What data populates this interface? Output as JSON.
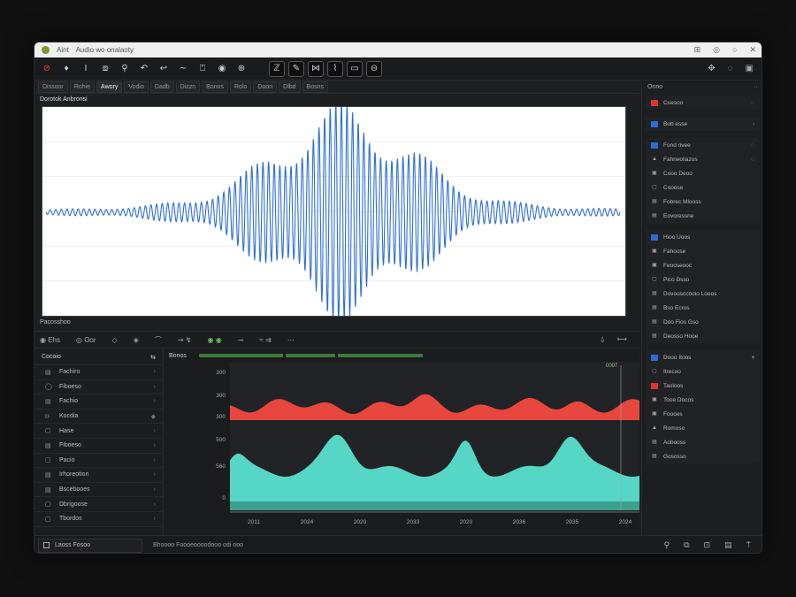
{
  "window": {
    "title_prefix": "Aint",
    "title": "Audio wo onalaoty",
    "controls": [
      "⊞",
      "◎",
      "○",
      "✕"
    ]
  },
  "toolbar": {
    "left_icons": [
      {
        "name": "record-icon",
        "glyph": "⊘"
      },
      {
        "name": "pin-icon",
        "glyph": "♦"
      },
      {
        "name": "cursor-icon",
        "glyph": "I"
      },
      {
        "name": "screen-icon",
        "glyph": "⧈"
      },
      {
        "name": "search-icon",
        "glyph": "⚲"
      },
      {
        "name": "undo-icon",
        "glyph": "↶"
      },
      {
        "name": "back-icon",
        "glyph": "↩"
      },
      {
        "name": "wave-icon",
        "glyph": "∼"
      },
      {
        "name": "marker-icon",
        "glyph": "⍞"
      },
      {
        "name": "mic-icon",
        "glyph": "◉"
      },
      {
        "name": "zoom-icon",
        "glyph": "⊕"
      }
    ],
    "boxed_icons": [
      {
        "name": "trim-icon",
        "glyph": "ℤ"
      },
      {
        "name": "pen-icon",
        "glyph": "✎"
      },
      {
        "name": "split-icon",
        "glyph": "⋈"
      },
      {
        "name": "envelope-icon",
        "glyph": "⌇"
      },
      {
        "name": "frame-icon",
        "glyph": "▭"
      },
      {
        "name": "clock-icon",
        "glyph": "⊖"
      }
    ],
    "right_icons": [
      {
        "name": "move-icon",
        "glyph": "✥"
      },
      {
        "name": "chat-icon",
        "glyph": "◌"
      },
      {
        "name": "save-icon",
        "glyph": "▣"
      }
    ]
  },
  "tabs": [
    {
      "label": "Dissoor",
      "active": false
    },
    {
      "label": "Rohie",
      "active": false
    },
    {
      "label": "Awory",
      "active": true
    },
    {
      "label": "Vodio",
      "active": false
    },
    {
      "label": "Dadb",
      "active": false
    },
    {
      "label": "Dizzn",
      "active": false
    },
    {
      "label": "Bonos",
      "active": false
    },
    {
      "label": "Rolo",
      "active": false
    },
    {
      "label": "Doon",
      "active": false
    },
    {
      "label": "Dlbd",
      "active": false
    },
    {
      "label": "Bosns",
      "active": false
    }
  ],
  "waveform": {
    "label": "Dorotok Anbronsi",
    "color": "#2f6fd8"
  },
  "freq_label": "Pacosshoo",
  "transport": {
    "items": [
      "◉  Ehs",
      "◎  Oor",
      "◇",
      "◈",
      "⌒",
      "⇝  ↯",
      "◉  ◉",
      "⊸",
      "≈  ⇉",
      "⋯"
    ],
    "right": [
      "⍙",
      "⟷"
    ]
  },
  "left_panel": {
    "header": "Cocoio",
    "header_icon": "⇆",
    "items": [
      {
        "icon": "▤",
        "label": "Fachiro",
        "chev": "›"
      },
      {
        "icon": "◯",
        "label": "Fiboeso",
        "chev": "›"
      },
      {
        "icon": "▤",
        "label": "Fachio",
        "chev": "›"
      },
      {
        "icon": "⊪",
        "label": "Kocdia",
        "chev": "◆"
      },
      {
        "icon": "▢",
        "label": "Hase",
        "chev": "›"
      },
      {
        "icon": "▤",
        "label": "Fiboeso",
        "chev": "›"
      },
      {
        "icon": "▢",
        "label": "Pacio",
        "chev": "›"
      },
      {
        "icon": "▤",
        "label": "Irhoreotion",
        "chev": "›"
      },
      {
        "icon": "▤",
        "label": "Bscebooes",
        "chev": "›"
      },
      {
        "icon": "▢",
        "label": "Dbrigoose",
        "chev": "›"
      },
      {
        "icon": "▢",
        "label": "Tbordos",
        "chev": "›"
      }
    ]
  },
  "spectrum": {
    "label": "Bonos",
    "cursor_label": "0007",
    "red_color": "#e8473e",
    "teal_color": "#56d6c4",
    "y_ticks": [
      "300",
      "300",
      "300",
      "500",
      "560",
      "0"
    ],
    "x_ticks": [
      "2011",
      "2024",
      "2020",
      "2033",
      "2020",
      "2036",
      "2035",
      "2024"
    ]
  },
  "right_panel": {
    "header": "Onno",
    "header_right": "··",
    "groups": [
      [
        {
          "ic": "red",
          "label": "Cuesoo",
          "end": "◌"
        }
      ],
      [
        {
          "ic": "blue",
          "label": "Bob esse",
          "end": "›"
        }
      ],
      [
        {
          "ic": "blue",
          "label": "Fond rivee",
          "end": "◌"
        },
        {
          "ic": "",
          "glyph": "▲",
          "label": "Fahneoliazos",
          "end": "◌"
        },
        {
          "ic": "",
          "glyph": "▣",
          "label": "Cooo Deoo",
          "end": ""
        },
        {
          "ic": "",
          "glyph": "▢",
          "label": "Cooose",
          "end": ""
        },
        {
          "ic": "",
          "glyph": "▤",
          "label": "Fobrec Mlooss",
          "end": ""
        },
        {
          "ic": "",
          "glyph": "▤",
          "label": "Eovoressne",
          "end": ""
        }
      ],
      [
        {
          "ic": "blue",
          "label": "Hioo Uoos",
          "end": ""
        },
        {
          "ic": "",
          "glyph": "▣",
          "label": "Fahoose",
          "end": ""
        },
        {
          "ic": "",
          "glyph": "▣",
          "label": "Feooseooc",
          "end": ""
        },
        {
          "ic": "",
          "glyph": "▢",
          "label": "Pico Dsso",
          "end": ""
        },
        {
          "ic": "",
          "glyph": "▤",
          "label": "Dovoosccooio Looos",
          "end": ""
        },
        {
          "ic": "",
          "glyph": "▤",
          "label": "Bso Ecros",
          "end": ""
        },
        {
          "ic": "",
          "glyph": "▤",
          "label": "Doo Fios Gso",
          "end": ""
        },
        {
          "ic": "",
          "glyph": "▤",
          "label": "Deosso Hooe",
          "end": ""
        }
      ],
      [
        {
          "ic": "blue",
          "label": "Dooo Itoos",
          "end": "▾"
        },
        {
          "ic": "",
          "glyph": "▢",
          "label": "Itrecoo",
          "end": ""
        },
        {
          "ic": "red",
          "label": "Taoloos",
          "end": ""
        },
        {
          "ic": "",
          "glyph": "▣",
          "label": "Tooe Docos",
          "end": ""
        },
        {
          "ic": "",
          "glyph": "▣",
          "label": "Foooes",
          "end": ""
        },
        {
          "ic": "",
          "glyph": "▲",
          "label": "Romoso",
          "end": ""
        },
        {
          "ic": "",
          "glyph": "▤",
          "label": "Aobooss",
          "end": ""
        },
        {
          "ic": "",
          "glyph": "▤",
          "label": "Gososso",
          "end": ""
        }
      ]
    ]
  },
  "status": {
    "search_label": "Laoss Fosoo",
    "text": "Bhoooo Foooeoooodooo odi  ooo",
    "right_icons": [
      "⚲",
      "⧉",
      "⊡",
      "▤",
      "⍑"
    ]
  }
}
